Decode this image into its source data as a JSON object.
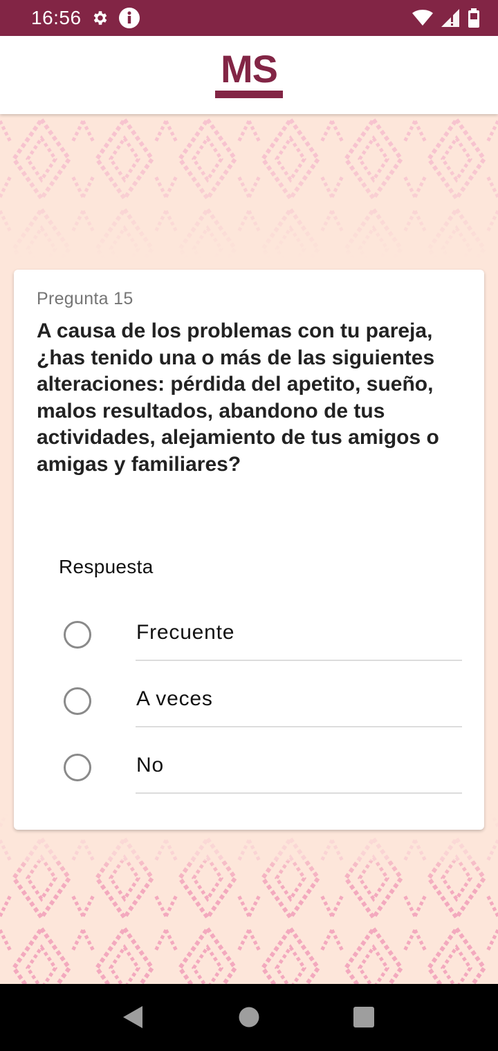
{
  "status_bar": {
    "time": "16:56",
    "icons": [
      "settings-icon",
      "info-icon",
      "wifi-icon",
      "signal-icon",
      "battery-icon"
    ]
  },
  "header": {
    "logo_text": "MS"
  },
  "question": {
    "number_label": "Pregunta 15",
    "text": "A causa de los problemas con tu pareja, ¿has tenido una o más de las siguientes alteraciones: pérdida del apetito, sueño, malos resultados, abandono de tus actividades, alejamiento de tus amigos o amigas y familiares?"
  },
  "answer": {
    "label": "Respuesta",
    "options": [
      {
        "label": "Frecuente",
        "selected": false
      },
      {
        "label": "A veces",
        "selected": false
      },
      {
        "label": "No",
        "selected": false
      }
    ]
  },
  "nav_bar": {
    "buttons": [
      "back-icon",
      "home-icon",
      "recents-icon"
    ]
  },
  "colors": {
    "brand": "#822545",
    "background": "#fde6da",
    "pattern": "#f7b7c9"
  }
}
